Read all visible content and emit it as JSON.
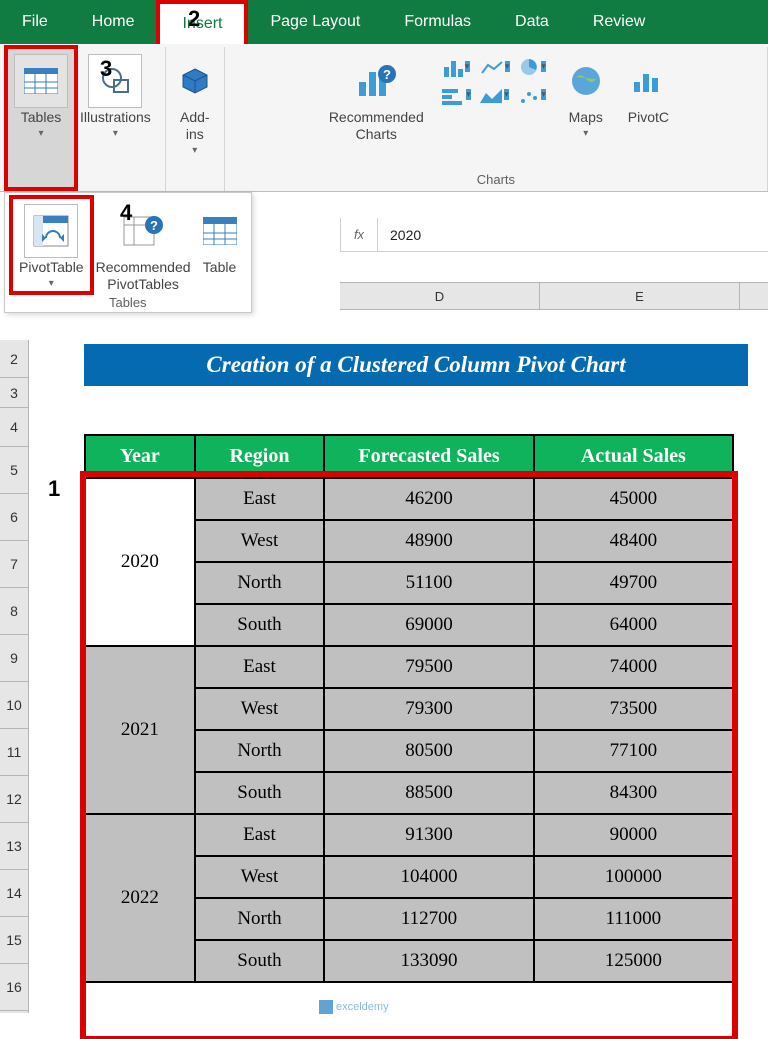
{
  "ribbon": {
    "tabs": [
      "File",
      "Home",
      "Insert",
      "Page Layout",
      "Formulas",
      "Data",
      "Review"
    ],
    "active_tab": "Insert",
    "groups": {
      "tables": {
        "label": "Tables",
        "tables_btn": "Tables",
        "pivottable_btn": "PivotTable",
        "recommended_btn": "Recommended\nPivotTables",
        "table_btn": "Table"
      },
      "illustrations": {
        "btn": "Illustrations"
      },
      "addins": {
        "btn": "Add-\nins"
      },
      "rec_charts": {
        "btn": "Recommended\nCharts"
      },
      "charts": {
        "label": "Charts",
        "maps": "Maps",
        "pivot": "PivotC"
      }
    }
  },
  "callouts": {
    "c1": "1",
    "c2": "2",
    "c3": "3",
    "c4": "4"
  },
  "formula_bar": {
    "fx": "fx",
    "value": "2020"
  },
  "col_headers": [
    "D",
    "E"
  ],
  "row_headers": [
    "2",
    "3",
    "4",
    "5",
    "6",
    "7",
    "8",
    "9",
    "10",
    "11",
    "12",
    "13",
    "14",
    "15",
    "16"
  ],
  "title": "Creation of a Clustered Column Pivot Chart",
  "table_headers": [
    "Year",
    "Region",
    "Forecasted Sales",
    "Actual Sales"
  ],
  "data": [
    {
      "year": "2020",
      "rows": [
        {
          "region": "East",
          "forecast": "46200",
          "actual": "45000"
        },
        {
          "region": "West",
          "forecast": "48900",
          "actual": "48400"
        },
        {
          "region": "North",
          "forecast": "51100",
          "actual": "49700"
        },
        {
          "region": "South",
          "forecast": "69000",
          "actual": "64000"
        }
      ]
    },
    {
      "year": "2021",
      "rows": [
        {
          "region": "East",
          "forecast": "79500",
          "actual": "74000"
        },
        {
          "region": "West",
          "forecast": "79300",
          "actual": "73500"
        },
        {
          "region": "North",
          "forecast": "80500",
          "actual": "77100"
        },
        {
          "region": "South",
          "forecast": "88500",
          "actual": "84300"
        }
      ]
    },
    {
      "year": "2022",
      "rows": [
        {
          "region": "East",
          "forecast": "91300",
          "actual": "90000"
        },
        {
          "region": "West",
          "forecast": "104000",
          "actual": "100000"
        },
        {
          "region": "North",
          "forecast": "112700",
          "actual": "111000"
        },
        {
          "region": "South",
          "forecast": "133090",
          "actual": "125000"
        }
      ]
    }
  ],
  "watermark": "exceldemy"
}
